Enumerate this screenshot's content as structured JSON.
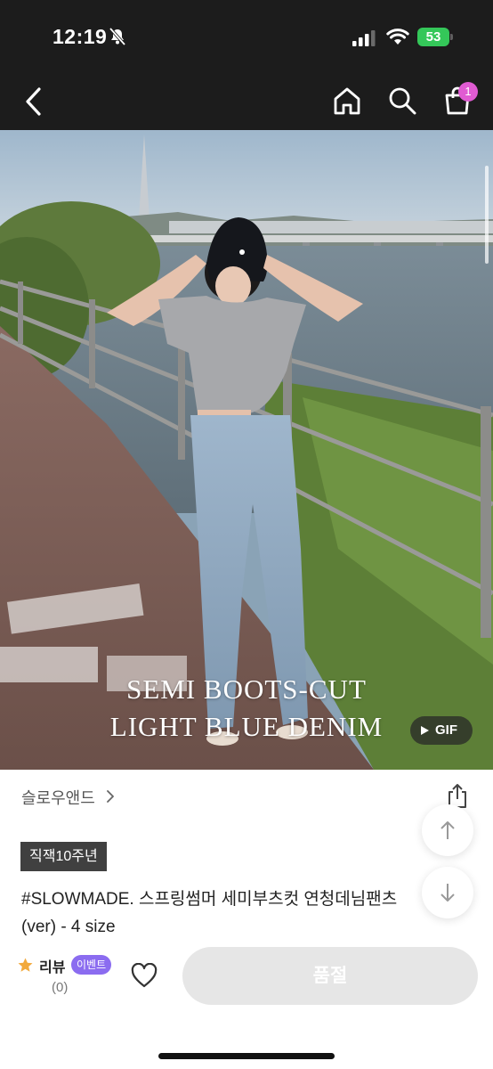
{
  "status_bar": {
    "time": "12:19",
    "battery": "53"
  },
  "nav": {
    "cart_count": "1"
  },
  "product_image": {
    "caption_line1": "SEMI BOOTS-CUT",
    "caption_line2": "LIGHT BLUE DENIM",
    "gif_label": "GIF"
  },
  "product": {
    "brand": "슬로우앤드",
    "tag": "직잭10주년",
    "title": "#SLOWMADE. 스프링썸머 세미부츠컷 연청데님팬츠 (ver) - 4 size"
  },
  "bottom_bar": {
    "review_label": "리뷰",
    "event_badge": "이벤트",
    "review_count": "(0)",
    "soldout_label": "품절"
  },
  "colors": {
    "topbar": "#1c1c1c",
    "cart_badge": "#e05bd2",
    "event_badge": "#8b6cf0",
    "battery": "#34c759",
    "star": "#f2a93b"
  }
}
